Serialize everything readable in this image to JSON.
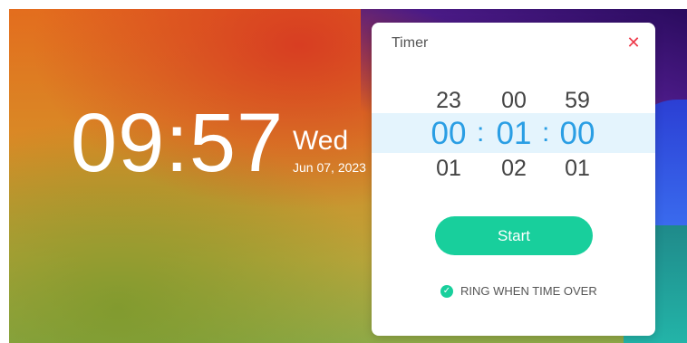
{
  "clock": {
    "time": "09:57",
    "day": "Wed",
    "date": "Jun 07, 2023"
  },
  "timer": {
    "title": "Timer",
    "close_icon": "close-icon",
    "hours": {
      "prev": "23",
      "current": "00",
      "next": "01"
    },
    "minutes": {
      "prev": "00",
      "current": "01",
      "next": "02"
    },
    "seconds": {
      "prev": "59",
      "current": "00",
      "next": "01"
    },
    "separator": ":",
    "start_label": "Start",
    "ring_label": "RING WHEN TIME OVER",
    "ring_checked": true
  },
  "colors": {
    "accent_blue": "#2a9ee4",
    "accent_green": "#18cf9c",
    "close_red": "#ee3a4a"
  }
}
